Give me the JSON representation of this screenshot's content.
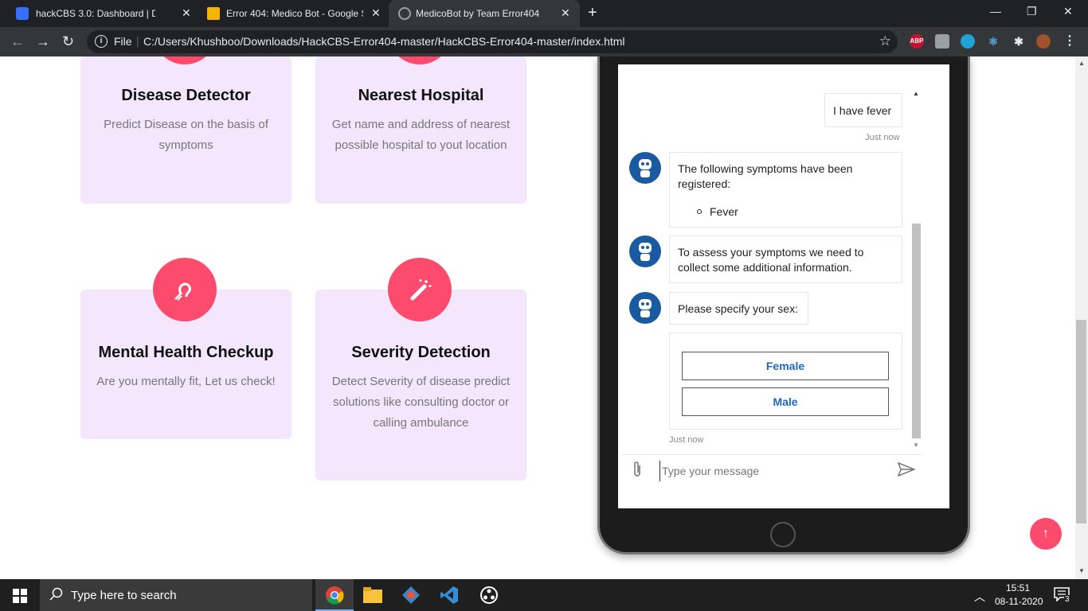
{
  "browser": {
    "tabs": [
      {
        "title": "hackCBS 3.0: Dashboard | Devfolio",
        "close": "✕"
      },
      {
        "title": "Error 404: Medico Bot - Google Slides",
        "close": "✕"
      },
      {
        "title": "MedicoBot by Team Error404",
        "close": "✕"
      }
    ],
    "new_tab": "+",
    "window_controls": {
      "minimize": "—",
      "restore": "❐",
      "close": "✕"
    },
    "file_label": "File",
    "url": "C:/Users/Khushboo/Downloads/HackCBS-Error404-master/HackCBS-Error404-master/index.html",
    "extensions": [
      "ABP"
    ]
  },
  "features": [
    {
      "title": "Disease Detector",
      "description": "Predict Disease on the basis of symptoms"
    },
    {
      "title": "Nearest Hospital",
      "description": "Get name and address of nearest possible hospital to yout location"
    },
    {
      "title": "Mental Health Checkup",
      "description": "Are you mentally fit, Let us check!"
    },
    {
      "title": "Severity Detection",
      "description": "Detect Severity of disease predict solutions like consulting doctor or calling ambulance"
    }
  ],
  "chat": {
    "user_message": "I have fever",
    "user_time": "Just now",
    "bot_messages": [
      "The following symptoms have been registered:",
      "To assess your symptoms we need to collect some additional information.",
      "Please specify your sex:"
    ],
    "symptoms": [
      "Fever"
    ],
    "options": [
      "Female",
      "Male"
    ],
    "options_time": "Just now",
    "input_placeholder": "Type your message"
  },
  "taskbar": {
    "search_placeholder": "Type here to search",
    "time": "15:51",
    "date": "08-11-2020",
    "notifications": "3"
  },
  "colors": {
    "accent": "#fc4b6c",
    "card_bg": "#f4e6fd",
    "bot_avatar": "#1a5aa0",
    "option_text": "#1a6bc0"
  }
}
